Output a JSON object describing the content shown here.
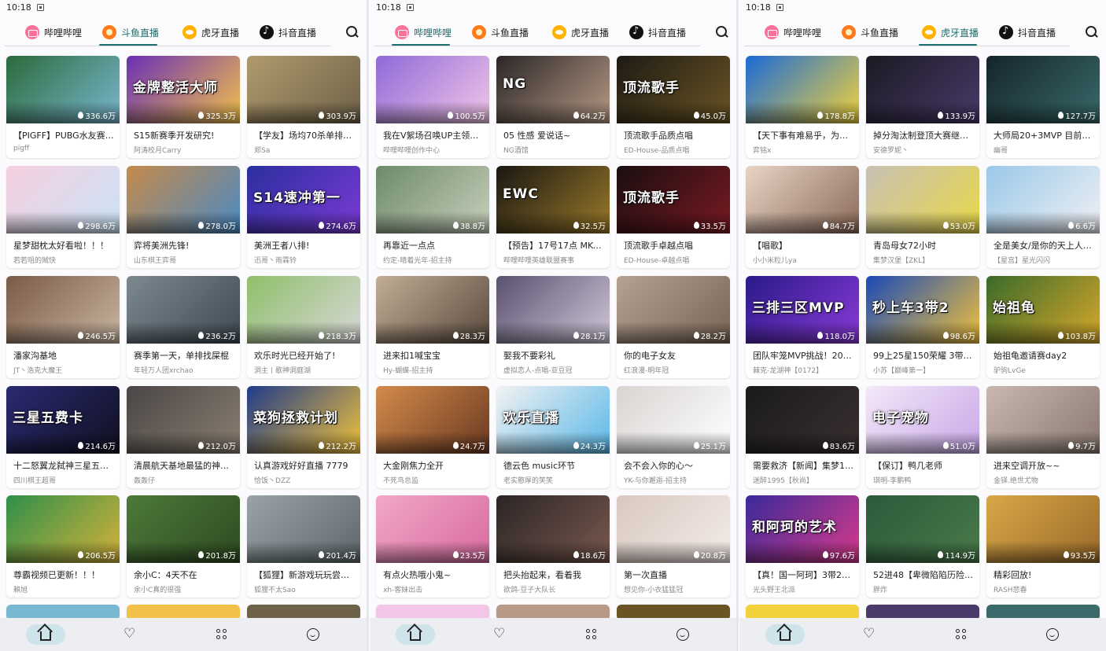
{
  "status": {
    "time": "10:18"
  },
  "tabs": [
    {
      "key": "bilibili",
      "label": "哔哩哔哩",
      "logo": "bilibili-logo-icon",
      "color": "#fb7299"
    },
    {
      "key": "douyu",
      "label": "斗鱼直播",
      "logo": "douyu-logo-icon",
      "color": "#ff7a1a"
    },
    {
      "key": "huya",
      "label": "虎牙直播",
      "logo": "huya-logo-icon",
      "color": "#ffb200"
    },
    {
      "key": "douyin",
      "label": "抖音直播",
      "logo": "douyin-logo-icon",
      "color": "#111111"
    }
  ],
  "accent_color": "#1e6e6e",
  "nav": [
    {
      "key": "home",
      "icon": "home-icon"
    },
    {
      "key": "favorite",
      "icon": "heart-icon"
    },
    {
      "key": "category",
      "icon": "grid-icon"
    },
    {
      "key": "mine",
      "icon": "smile-icon"
    }
  ],
  "panels": [
    {
      "active_tab": "douyu",
      "cards": [
        {
          "title": "【PIGFF】PUBG水友赛1…",
          "owner": "pigff",
          "viewers": "336.6万",
          "bg": "#2b6a3a",
          "bg2": "#7ab7d0",
          "thumb_text": ""
        },
        {
          "title": "S15新赛季开发研究!",
          "owner": "阿涛校月Carry",
          "viewers": "325.3万",
          "bg": "#6b2fb5",
          "bg2": "#f2c14a",
          "thumb_text": "金牌整活大师"
        },
        {
          "title": "【学友】场均70杀单排…",
          "owner": "郑Sa",
          "viewers": "303.9万",
          "bg": "#b09a6d",
          "bg2": "#6e6248",
          "thumb_text": ""
        },
        {
          "title": "星梦甜枕太好看啦！！！",
          "owner": "若若咀的贼快",
          "viewers": "298.6万",
          "bg": "#f6cfe0",
          "bg2": "#c9e3f5",
          "thumb_text": ""
        },
        {
          "title": "弈将美洲先锋!",
          "owner": "山东棋王弈哥",
          "viewers": "278.0万",
          "bg": "#c58a4a",
          "bg2": "#4a8ac5",
          "thumb_text": ""
        },
        {
          "title": "美洲王者八排!",
          "owner": "迅哥丶雨霖铃",
          "viewers": "274.6万",
          "bg": "#2a2f9e",
          "bg2": "#7c3ad6",
          "thumb_text": "S14速冲第一"
        },
        {
          "title": "潘家沟基地",
          "owner": "JT丶浩克大魔王",
          "viewers": "246.5万",
          "bg": "#7a5a45",
          "bg2": "#c9b6a2",
          "thumb_text": ""
        },
        {
          "title": "赛季第一天，单排找屎棍",
          "owner": "年轻万人团xrchao",
          "viewers": "236.2万",
          "bg": "#7d8890",
          "bg2": "#3e4a52",
          "thumb_text": ""
        },
        {
          "title": "欢乐时光已经开始了!",
          "owner": "洞主丨歌神洞庭湖",
          "viewers": "218.3万",
          "bg": "#8fbf6a",
          "bg2": "#d8d8d8",
          "thumb_text": ""
        },
        {
          "title": "十二怒翼龙弑神三星五…",
          "owner": "四川棋王超哥",
          "viewers": "214.6万",
          "bg": "#2a2a72",
          "bg2": "#101020",
          "thumb_text": "三星五费卡"
        },
        {
          "title": "清晨航天基地最猛的神…",
          "owner": "轰轰仔",
          "viewers": "212.0万",
          "bg": "#4a4646",
          "bg2": "#8a7e70",
          "thumb_text": ""
        },
        {
          "title": "认真游戏好好直播 7779",
          "owner": "恰饭丶DZZ",
          "viewers": "212.2万",
          "bg": "#1f3a8a",
          "bg2": "#f2c33a",
          "thumb_text": "菜狗拯救计划"
        },
        {
          "title": "尊霸视频已更新！！！",
          "owner": "賴旭",
          "viewers": "206.5万",
          "bg": "#2f8f4a",
          "bg2": "#d4b23a",
          "thumb_text": ""
        },
        {
          "title": "余小C：4天不在",
          "owner": "余小C真的很强",
          "viewers": "201.8万",
          "bg": "#4d7a38",
          "bg2": "#2e4a22",
          "thumb_text": ""
        },
        {
          "title": "【狐狸】新游戏玩玩尝…",
          "owner": "狐狸不太Sao",
          "viewers": "201.4万",
          "bg": "#9aa4a8",
          "bg2": "#5e686c",
          "thumb_text": ""
        }
      ]
    },
    {
      "active_tab": "bilibili",
      "cards": [
        {
          "title": "我在V絮场召唤UP主领…",
          "owner": "哔哩哔哩创作中心",
          "viewers": "100.5万",
          "bg": "#8f6ad8",
          "bg2": "#f3c6e8",
          "thumb_text": ""
        },
        {
          "title": "05 性感 爱说话~",
          "owner": "NG酒馆",
          "viewers": "64.2万",
          "bg": "#2a2626",
          "bg2": "#b79a86",
          "thumb_text": "NG"
        },
        {
          "title": "顶流歌手品质点唱",
          "owner": "ED-House-品质点唱",
          "viewers": "45.0万",
          "bg": "#1e1a14",
          "bg2": "#6a5424",
          "thumb_text": "顶流歌手"
        },
        {
          "title": "再靠近一点点",
          "owner": "约定-晴着光年-招主持",
          "viewers": "38.8万",
          "bg": "#6d8a6a",
          "bg2": "#c8d0bc",
          "thumb_text": ""
        },
        {
          "title": "【预告】17号17点 MKOI…",
          "owner": "哔哩哔哩英雄联盟赛事",
          "viewers": "32.5万",
          "bg": "#1a1712",
          "bg2": "#9a7a2a",
          "thumb_text": "EWC"
        },
        {
          "title": "顶流歌手卓越点唱",
          "owner": "ED-House-卓越点唱",
          "viewers": "33.5万",
          "bg": "#1a0e10",
          "bg2": "#7a1a22",
          "thumb_text": "顶流歌手"
        },
        {
          "title": "进来扣1喊宝宝",
          "owner": "Hy-蝴蝶-招主持",
          "viewers": "28.3万",
          "bg": "#c2ae96",
          "bg2": "#5a4a3e",
          "thumb_text": ""
        },
        {
          "title": "娶我不要彩礼",
          "owner": "虚拟恋人-点唱-亚豆冠",
          "viewers": "28.1万",
          "bg": "#5a5070",
          "bg2": "#d0c8d8",
          "thumb_text": ""
        },
        {
          "title": "你的电子女友",
          "owner": "红浪漫-明年冠",
          "viewers": "28.2万",
          "bg": "#b4a292",
          "bg2": "#786454",
          "thumb_text": ""
        },
        {
          "title": "大金刚焦力全开",
          "owner": "不死鸟总监",
          "viewers": "24.7万",
          "bg": "#d48a4a",
          "bg2": "#6a3a22",
          "thumb_text": ""
        },
        {
          "title": "德云色 music环节",
          "owner": "老实憨厚的笑笑",
          "viewers": "24.3万",
          "bg": "#f2f2f2",
          "bg2": "#5ab8e8",
          "thumb_text": "欢乐直播"
        },
        {
          "title": "会不会入你的心～",
          "owner": "YK-与你邂逅-招主持",
          "viewers": "25.1万",
          "bg": "#d8d4d2",
          "bg2": "#ffffff",
          "thumb_text": ""
        },
        {
          "title": "有点火热哦小鬼~",
          "owner": "xh-客妹出击",
          "viewers": "23.5万",
          "bg": "#f2a8c8",
          "bg2": "#d86aa0",
          "thumb_text": ""
        },
        {
          "title": "把头抬起来，看着我",
          "owner": "欲鸽-豆子大队长",
          "viewers": "18.6万",
          "bg": "#2a2424",
          "bg2": "#7a5a50",
          "thumb_text": ""
        },
        {
          "title": "第一次直播",
          "owner": "想见你-小衣猛猛冠",
          "viewers": "20.8万",
          "bg": "#d8c8c0",
          "bg2": "#f4ece8",
          "thumb_text": ""
        }
      ]
    },
    {
      "active_tab": "huya",
      "cards": [
        {
          "title": "【天下事有难易乎，为…",
          "owner": "弈铭x",
          "viewers": "178.8万",
          "bg": "#1a6ad8",
          "bg2": "#f2d23a",
          "thumb_text": ""
        },
        {
          "title": "掉分淘汰制登顶大赛继…",
          "owner": "安德罗妮丶",
          "viewers": "133.9万",
          "bg": "#1a1a22",
          "bg2": "#4a3a6a",
          "thumb_text": ""
        },
        {
          "title": "大师局20+3MVP 目前19…",
          "owner": "幽哥",
          "viewers": "127.7万",
          "bg": "#14242a",
          "bg2": "#3a6a6a",
          "thumb_text": ""
        },
        {
          "title": "【唱歌】",
          "owner": "小小米粒儿ya",
          "viewers": "84.7万",
          "bg": "#e8d4c6",
          "bg2": "#8a6a58",
          "thumb_text": ""
        },
        {
          "title": "青岛母女72小时",
          "owner": "集梦汉堡【ZKL】",
          "viewers": "53.0万",
          "bg": "#c8c0b4",
          "bg2": "#e8d848",
          "thumb_text": ""
        },
        {
          "title": "全是美女/是你的天上人…",
          "owner": "【星宫】星光闪闪",
          "viewers": "6.6万",
          "bg": "#9ac8e8",
          "bg2": "#f0f0f4",
          "thumb_text": ""
        },
        {
          "title": "团队牢笼MVP挑战！208…",
          "owner": "棘克-龙湖神【0172】",
          "viewers": "118.0万",
          "bg": "#2a1a8a",
          "bg2": "#8a3ad8",
          "thumb_text": "三排三区MVP"
        },
        {
          "title": "99上25星150荣耀 3带2…",
          "owner": "小苏【巅峰第一】",
          "viewers": "98.6万",
          "bg": "#1a4ab8",
          "bg2": "#f2c23a",
          "thumb_text": "秒上车3带2"
        },
        {
          "title": "始祖龟邀请赛day2",
          "owner": "驴驹LvGe",
          "viewers": "103.8万",
          "bg": "#3a6a2a",
          "bg2": "#d8a82a",
          "thumb_text": "始祖龟"
        },
        {
          "title": "需要救济【新闻】集梦1…",
          "owner": "迷醉1995【秋尚】",
          "viewers": "83.6万",
          "bg": "#1a1a1a",
          "bg2": "#3a3030",
          "thumb_text": ""
        },
        {
          "title": "【保订】鸭几老师",
          "owner": "琪明-李鹏鸭",
          "viewers": "51.0万",
          "bg": "#f4e8f8",
          "bg2": "#c8a8e8",
          "thumb_text": "电子宠物"
        },
        {
          "title": "进来空调开放~~",
          "owner": "金铎.绝世尤物",
          "viewers": "9.7万",
          "bg": "#c8b8b0",
          "bg2": "#8a7870",
          "thumb_text": ""
        },
        {
          "title": "【真！国一阿珂】3带2…",
          "owner": "光头野王北派",
          "viewers": "97.6万",
          "bg": "#3a2a9a",
          "bg2": "#d83a8a",
          "thumb_text": "和阿珂的艺术"
        },
        {
          "title": "52进48【卑微陷陷历险…",
          "owner": "胖炸",
          "viewers": "114.9万",
          "bg": "#2a5a3a",
          "bg2": "#4a7a4a",
          "thumb_text": ""
        },
        {
          "title": "精彩回放!",
          "owner": "RASH悲春",
          "viewers": "93.5万",
          "bg": "#d8a848",
          "bg2": "#9a6a2a",
          "thumb_text": ""
        }
      ]
    }
  ]
}
